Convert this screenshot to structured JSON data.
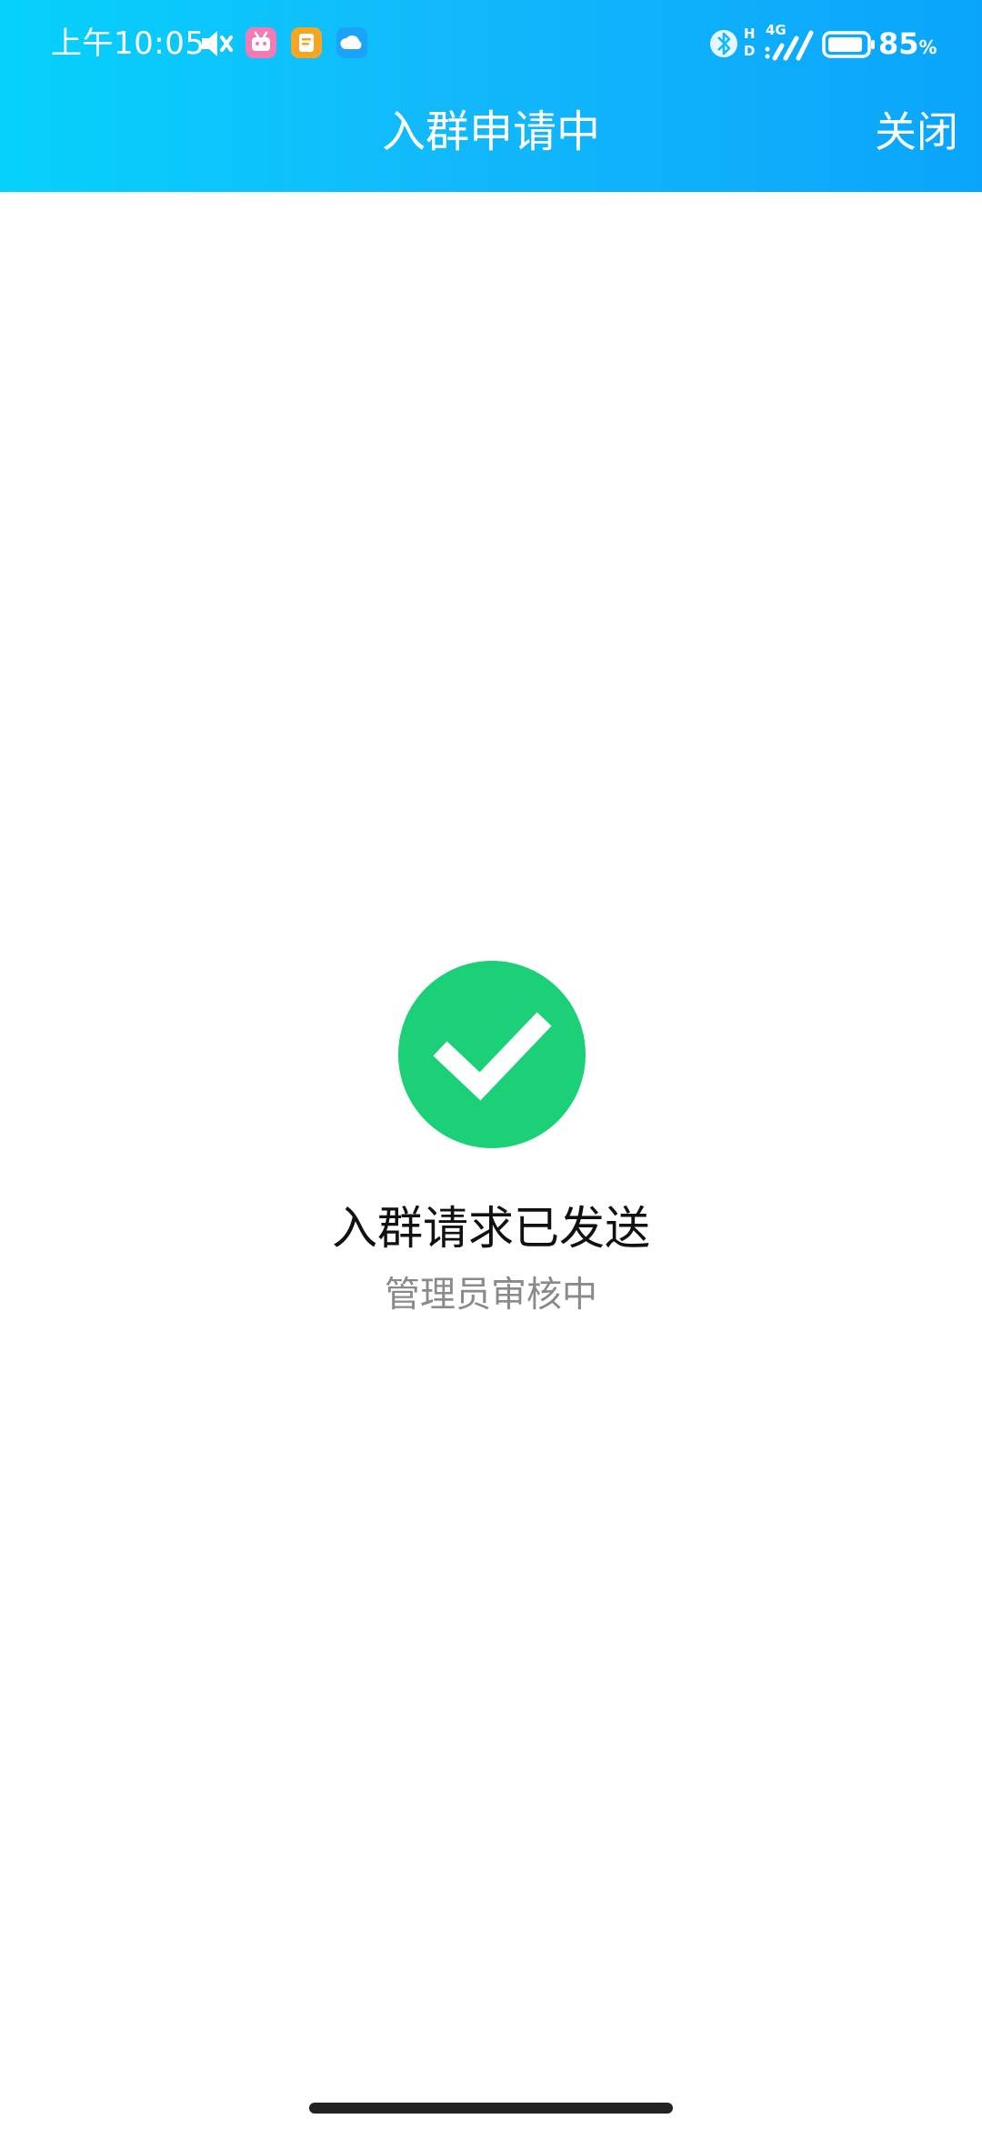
{
  "status_bar": {
    "time": "上午10:05",
    "network": "4G",
    "hd_top": "H",
    "hd_bottom": "D",
    "battery_level": "85",
    "battery_unit": "%"
  },
  "nav": {
    "title": "入群申请中",
    "close_label": "关闭"
  },
  "result": {
    "title": "入群请求已发送",
    "subtitle": "管理员审核中"
  },
  "colors": {
    "header_gradient_start": "#05d2fb",
    "header_gradient_end": "#0aa5fb",
    "success_green": "#1bd077",
    "subtitle_gray": "#8a8a8a"
  },
  "icons": {
    "status_left": [
      "mute-icon",
      "bilibili-app-icon",
      "note-app-icon",
      "cloud-app-icon"
    ],
    "status_right": [
      "bluetooth-icon",
      "hd-icon",
      "signal-icon",
      "battery-icon"
    ],
    "result": "checkmark-icon"
  }
}
